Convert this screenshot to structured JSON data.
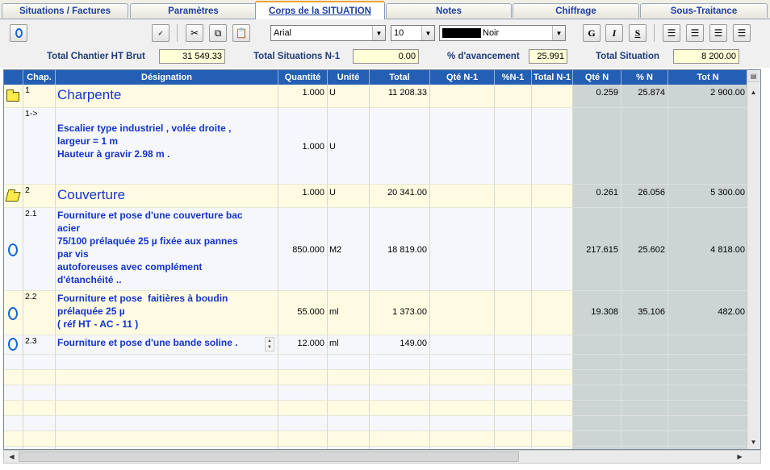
{
  "tabs": [
    {
      "label": "Situations / Factures",
      "active": false
    },
    {
      "label": "Paramètres",
      "active": false
    },
    {
      "label": "Corps de la SITUATION",
      "active": true
    },
    {
      "label": "Notes",
      "active": false
    },
    {
      "label": "Chiffrage",
      "active": false
    },
    {
      "label": "Sous-Traitance",
      "active": false
    }
  ],
  "toolbar": {
    "font": "Arial",
    "size": "10",
    "color_name": "Noir",
    "color_swatch": "#000000",
    "bold": "G",
    "italic": "I",
    "underline": "S"
  },
  "totals": {
    "total_chantier_label": "Total Chantier HT Brut",
    "total_chantier_value": "31 549.33",
    "total_situations_label": "Total Situations N-1",
    "total_situations_value": "0.00",
    "avancement_label": "% d'avancement",
    "avancement_value": "25.991",
    "total_situation_label": "Total Situation",
    "total_situation_value": "8 200.00"
  },
  "columns": [
    "Chap.",
    "Désignation",
    "Quantité",
    "Unité",
    "Total",
    "Qté N-1",
    "%N-1",
    "Total N-1",
    "Qté N",
    "% N",
    "Tot N"
  ],
  "rows": [
    {
      "icon": "folder",
      "chap": "1",
      "designation": "Charpente",
      "title": true,
      "quantite": "1.000",
      "unite": "U",
      "total": "11 208.33",
      "qte_n": "0.259",
      "pct_n": "25.874",
      "tot_n": "2 900.00"
    },
    {
      "icon": "",
      "chap": "1->",
      "designation": "\nEscalier type industriel , volée droite ,\nlargeur = 1 m\nHauteur à gravir 2.98 m .",
      "title": false,
      "quantite": "1.000",
      "unite": "U",
      "total": "",
      "qte_n": "",
      "pct_n": "",
      "tot_n": ""
    },
    {
      "icon": "folder-open",
      "chap": "2",
      "designation": "Couverture",
      "title": true,
      "quantite": "1.000",
      "unite": "U",
      "total": "20 341.00",
      "qte_n": "0.261",
      "pct_n": "26.056",
      "tot_n": "5 300.00"
    },
    {
      "icon": "ring",
      "chap": "2.1",
      "designation": "Fourniture et pose d'une couverture bac\nacier\n75/100 prélaquée 25 µ fixée aux pannes\npar vis\nautoforeuses avec complément\nd'étanchéité ..",
      "title": false,
      "quantite": "850.000",
      "unite": "M2",
      "total": "18 819.00",
      "qte_n": "217.615",
      "pct_n": "25.602",
      "tot_n": "4 818.00"
    },
    {
      "icon": "ring",
      "chap": "2.2",
      "designation": "Fourniture et pose  faitières à boudin\nprélaquée 25 µ\n( réf HT - AC - 11 )",
      "title": false,
      "quantite": "55.000",
      "unite": "ml",
      "total": "1 373.00",
      "qte_n": "19.308",
      "pct_n": "35.106",
      "tot_n": "482.00"
    },
    {
      "icon": "ring",
      "chap": "2.3",
      "designation": "Fourniture et pose d'une bande soline .",
      "title": false,
      "quantite": "12.000",
      "unite": "ml",
      "total": "149.00",
      "qte_n": "",
      "pct_n": "",
      "tot_n": ""
    }
  ]
}
